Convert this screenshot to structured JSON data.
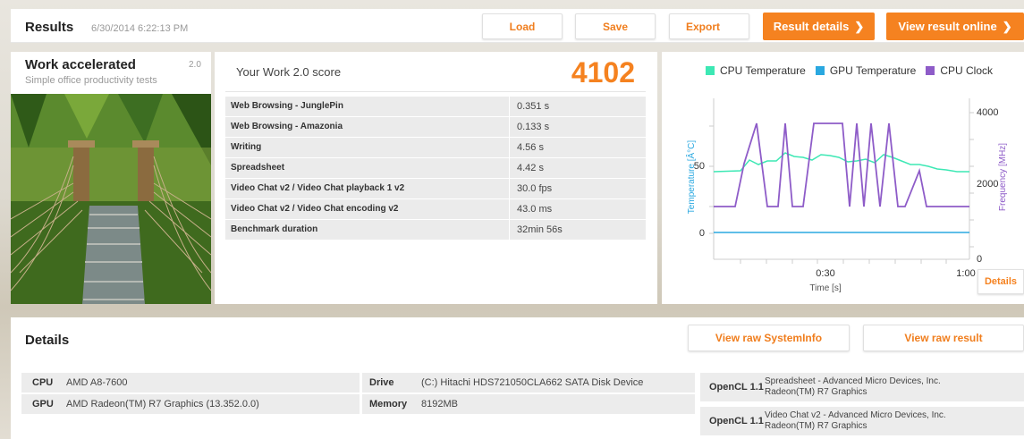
{
  "header": {
    "title": "Results",
    "date": "6/30/2014 6:22:13 PM",
    "buttons": {
      "load": "Load",
      "save": "Save",
      "export": "Export",
      "result_details": "Result details",
      "view_online": "View result online"
    }
  },
  "test": {
    "name": "Work accelerated",
    "version": "2.0",
    "subtitle": "Simple office productivity tests"
  },
  "score": {
    "label": "Your Work 2.0 score",
    "value": "4102"
  },
  "results": [
    {
      "name": "Web Browsing - JunglePin",
      "value": "0.351 s"
    },
    {
      "name": "Web Browsing - Amazonia",
      "value": "0.133 s"
    },
    {
      "name": "Writing",
      "value": "4.56 s"
    },
    {
      "name": "Spreadsheet",
      "value": "4.42 s"
    },
    {
      "name": "Video Chat v2 / Video Chat playback 1 v2",
      "value": "30.0 fps"
    },
    {
      "name": "Video Chat v2 / Video Chat encoding v2",
      "value": "43.0 ms"
    },
    {
      "name": "Benchmark duration",
      "value": "32min 56s"
    }
  ],
  "chart": {
    "legend": [
      "CPU Temperature",
      "GPU Temperature",
      "CPU Clock"
    ],
    "colors": {
      "cpu_temp": "#3de8b4",
      "gpu_temp": "#2aa8e0",
      "cpu_clock": "#8e5cc8"
    },
    "left_ticks": [
      "50",
      "0"
    ],
    "right_ticks": [
      "4000",
      "2000",
      "0"
    ],
    "x_ticks": [
      "0:30",
      "1:00"
    ],
    "ylabel_left": "Temperature [Â°C]",
    "ylabel_right": "Frequency [MHz]",
    "xlabel": "Time [s]",
    "details_label": "Details"
  },
  "details": {
    "title": "Details",
    "view_sysinfo": "View raw SystemInfo",
    "view_result": "View raw result",
    "cpu_label": "CPU",
    "cpu": "AMD A8-7600",
    "gpu_label": "GPU",
    "gpu": "AMD Radeon(TM) R7 Graphics (13.352.0.0)",
    "drive_label": "Drive",
    "drive": "(C:) Hitachi HDS721050CLA662 SATA Disk Device",
    "memory_label": "Memory",
    "memory": "8192MB",
    "opencl": [
      {
        "label": "OpenCL 1.1",
        "line1": "Spreadsheet - Advanced Micro Devices, Inc.",
        "line2": "Radeon(TM) R7 Graphics"
      },
      {
        "label": "OpenCL 1.1",
        "line1": "Video Chat v2 - Advanced Micro Devices, Inc.",
        "line2": "Radeon(TM) R7 Graphics"
      }
    ]
  }
}
